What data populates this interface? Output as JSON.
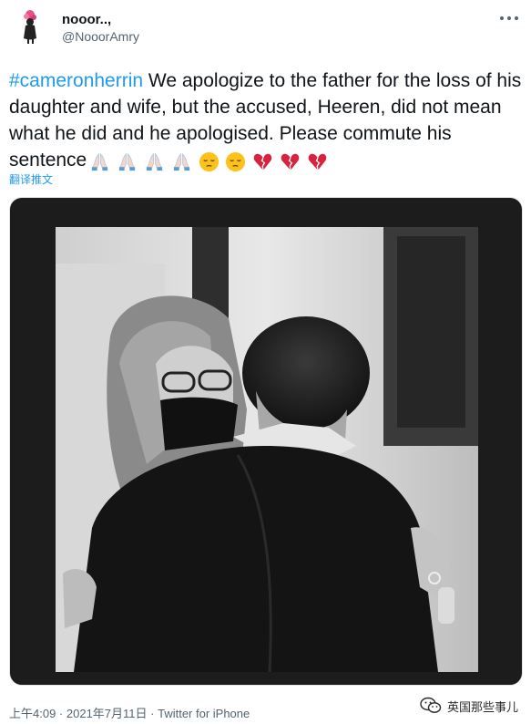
{
  "author": {
    "name": "nooor..,",
    "handle": "@NooorAmry"
  },
  "tweet": {
    "hashtag": "#cameronherrin",
    "text": " We apologize to the father for the loss of his daughter and wife, but the accused, Heeren, did not mean what he did and he apologised. Please commute his sentence",
    "emojis": [
      "folded-hands",
      "folded-hands",
      "folded-hands",
      "folded-hands",
      "pensive-face",
      "pensive-face",
      "broken-heart",
      "broken-heart",
      "broken-heart"
    ]
  },
  "translate_label": "翻译推文",
  "footer": {
    "time": "上午4:09",
    "separator": " · ",
    "date": "2021年7月11日",
    "source": "Twitter for iPhone"
  },
  "watermark": {
    "text": "英国那些事儿"
  },
  "colors": {
    "link": "#1d9bf0",
    "text": "#0f1419",
    "secondary": "#536471",
    "media_bg": "#1c1c1c"
  }
}
